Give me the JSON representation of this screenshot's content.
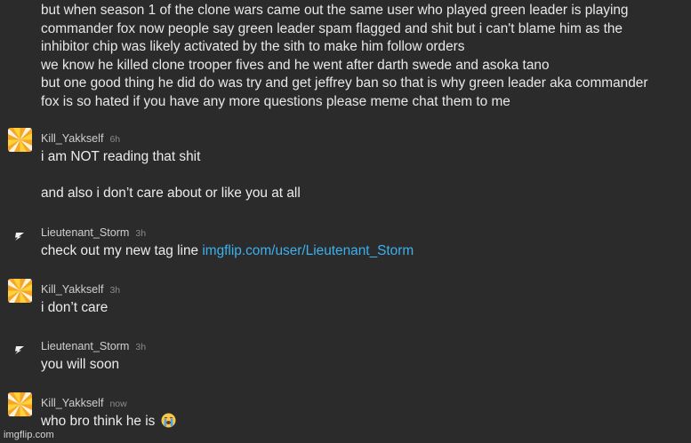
{
  "intro_lines": [
    "but when season 1 of the clone wars came out the same user who played green leader is playing",
    "commander fox now people say green leader spam flagged and shit but i can't blame him as the",
    "inhibitor chip was likely activated by the sith to make him follow orders",
    "we know he killed clone trooper fives and he went after darth swede and asoka tano",
    "but one good thing he did do was try and get jeffrey ban so that is why green leader aka commander",
    "fox is so hated if you have any more questions please meme chat them to me"
  ],
  "messages": [
    {
      "user": "Kill_Yakkself",
      "time": "6h",
      "avatar_icon": "pinwheel-avatar-icon",
      "line1": "i am NOT reading that shit",
      "line2": "and also i don’t care about or like you at all"
    },
    {
      "user": "Lieutenant_Storm",
      "time": "3h",
      "avatar_icon": "storm-avatar-icon",
      "text": "check out my new tag line ",
      "link": "imgflip.com/user/Lieutenant_Storm"
    },
    {
      "user": "Kill_Yakkself",
      "time": "3h",
      "avatar_icon": "pinwheel-avatar-icon",
      "text": "i don’t care"
    },
    {
      "user": "Lieutenant_Storm",
      "time": "3h",
      "avatar_icon": "storm-avatar-icon",
      "text": "you will soon"
    },
    {
      "user": "Kill_Yakkself",
      "time": "now",
      "avatar_icon": "pinwheel-avatar-icon",
      "text": "who bro think he is",
      "emoji": "loudly-crying-face-emoji"
    }
  ],
  "watermark": "imgflip.com",
  "colors": {
    "background": "#2b2b2b",
    "text": "#e8e8e8",
    "username": "#cfcfcf",
    "timestamp": "#8a8a8a",
    "link": "#3cb1f0",
    "pinwheel_orange": "#f5a623",
    "pinwheel_yellow": "#ffd23a"
  }
}
